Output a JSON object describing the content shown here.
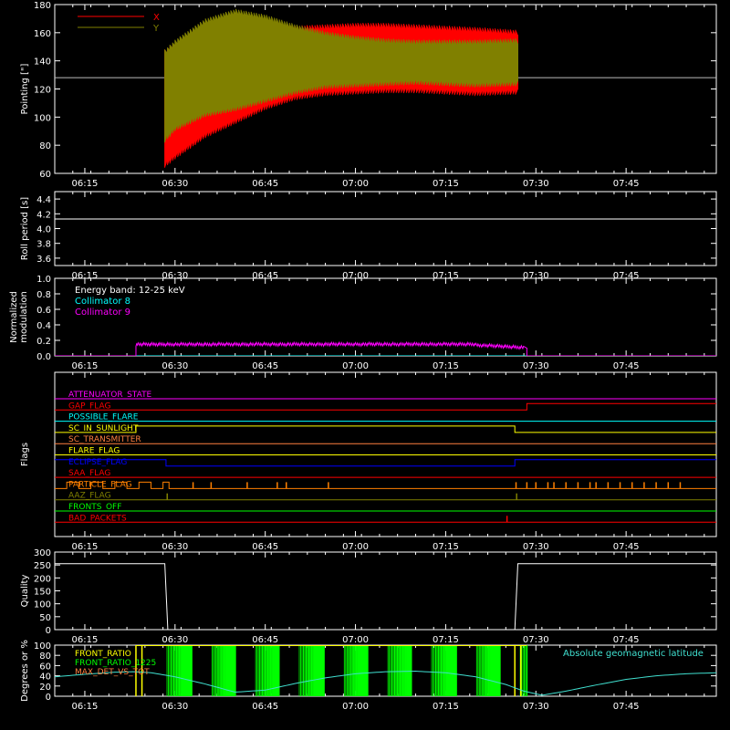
{
  "time_axis": {
    "min_minutes": 370,
    "max_minutes": 480,
    "tick_labels": [
      "06:15",
      "06:30",
      "06:45",
      "07:00",
      "07:15",
      "07:30",
      "07:45"
    ],
    "tick_minutes": [
      375,
      390,
      405,
      420,
      435,
      450,
      465
    ]
  },
  "chart_data": [
    {
      "type": "area",
      "ylabel": "Pointing [\"]",
      "ylim": [
        60,
        180
      ],
      "yticks": [
        60,
        80,
        100,
        120,
        140,
        160,
        180
      ],
      "grid": false,
      "legend_position": "top-left",
      "reference_line": 128,
      "series": [
        {
          "name": "X",
          "color": "#ff0000",
          "band": {
            "t": [
              388.3,
              390,
              395,
              400,
              405,
              410,
              415,
              420,
              425,
              430,
              435,
              440,
              447
            ],
            "upper": [
              148,
              152,
              158,
              163,
              166,
              165,
              166,
              167,
              167,
              166,
              165,
              164,
              162
            ],
            "lower": [
              64,
              70,
              85,
              95,
              105,
              112,
              115,
              116,
              117,
              117,
              116,
              115,
              116
            ]
          }
        },
        {
          "name": "Y",
          "color": "#808000",
          "band": {
            "t": [
              388.3,
              390,
              395,
              400,
              405,
              410,
              415,
              420,
              425,
              430,
              435,
              440,
              447
            ],
            "upper": [
              148,
              155,
              170,
              177,
              173,
              166,
              161,
              158,
              156,
              155,
              155,
              155,
              156
            ],
            "lower": [
              82,
              90,
              100,
              104,
              110,
              116,
              120,
              121,
              122,
              123,
              122,
              121,
              122
            ]
          }
        }
      ]
    },
    {
      "type": "line",
      "ylabel": "Roll period [s]",
      "ylim": [
        3.5,
        4.5
      ],
      "yticks": [
        3.6,
        3.8,
        4.0,
        4.2,
        4.4
      ],
      "tick_labels": [
        "3.6",
        "3.8",
        "4.0",
        "4.2",
        "4.4"
      ],
      "grid": false,
      "series": [
        {
          "name": "",
          "color": "#ffffff",
          "x": [
            370,
            480
          ],
          "y": [
            4.13,
            4.13
          ]
        }
      ]
    },
    {
      "type": "line",
      "ylabel": [
        "Normalized",
        "modulation"
      ],
      "ylim": [
        0.0,
        1.0
      ],
      "yticks": [
        0.0,
        0.2,
        0.4,
        0.6,
        0.8,
        1.0
      ],
      "tick_labels": [
        "0.0",
        "0.2",
        "0.4",
        "0.6",
        "0.8",
        "1.0"
      ],
      "annotation": "Energy band: 12-25 keV",
      "grid": false,
      "series": [
        {
          "name": "Collimator 8",
          "color": "#00ffff",
          "x": [
            370,
            480
          ],
          "y": [
            0,
            0
          ]
        },
        {
          "name": "Collimator 9",
          "color": "#ff00ff",
          "x": [
            370,
            383.5,
            383.5,
            390,
            400,
            410,
            420,
            430,
            440,
            448,
            448.5,
            448.5,
            480
          ],
          "y": [
            0,
            0,
            0.15,
            0.16,
            0.15,
            0.15,
            0.15,
            0.16,
            0.14,
            0.13,
            0.1,
            0,
            0
          ]
        }
      ]
    },
    {
      "type": "line",
      "ylabel": "Flags",
      "grid": false,
      "series": [
        {
          "name": "ATTENUATOR_STATE",
          "color": "#ff00ff",
          "x": [
            370,
            480
          ],
          "y": [
            0,
            0
          ]
        },
        {
          "name": "GAP_FLAG",
          "color": "#ff0000",
          "x": [
            370,
            448.5,
            448.5,
            480
          ],
          "y": [
            0,
            0,
            1,
            1
          ]
        },
        {
          "name": "POSSIBLE_FLARE",
          "color": "#00ffff",
          "x": [
            370,
            480
          ],
          "y": [
            0,
            0
          ]
        },
        {
          "name": "SC_IN_SUNLIGHT",
          "color": "#ffff00",
          "x": [
            370,
            383.5,
            383.5,
            388.5,
            388.5,
            446.5,
            446.5,
            480
          ],
          "y": [
            0,
            0,
            1,
            1,
            1,
            1,
            0,
            0
          ]
        },
        {
          "name": "SC_TRANSMITTER",
          "color": "#ff8040",
          "x": [
            370,
            480
          ],
          "y": [
            0,
            0
          ]
        },
        {
          "name": "FLARE_FLAG",
          "color": "#ffff00",
          "x": [
            370,
            480
          ],
          "y": [
            0,
            0
          ]
        },
        {
          "name": "ECLIPSE_FLAG",
          "color": "#0000ff",
          "x": [
            370,
            388.5,
            388.5,
            446.5,
            446.5,
            480
          ],
          "y": [
            1,
            1,
            0,
            0,
            1,
            1
          ]
        },
        {
          "name": "SAA_FLAG",
          "color": "#ff0000",
          "x": [
            370,
            480
          ],
          "y": [
            0,
            0
          ]
        },
        {
          "name": "PARTICLE_FLAG",
          "color": "#ff8000",
          "x": [
            370,
            372,
            372,
            374,
            374,
            376,
            376,
            378,
            378,
            380,
            380,
            382,
            382,
            384,
            384,
            386,
            386,
            388,
            388,
            389,
            389,
            480
          ],
          "y": [
            0,
            0,
            1,
            1,
            0,
            0,
            1,
            1,
            0,
            0,
            1,
            1,
            0,
            0,
            1,
            1,
            0,
            0,
            1,
            1,
            0,
            0
          ],
          "spikes": [
            393,
            396,
            402,
            407,
            408.5,
            415.5,
            446.7,
            448.5,
            450,
            452,
            453,
            455,
            457,
            459,
            460,
            462,
            464,
            466,
            468,
            470,
            472,
            474
          ]
        },
        {
          "name": "AAZ_FLAG",
          "color": "#808000",
          "x": [
            370,
            480
          ],
          "y": [
            0,
            0
          ],
          "spikes": [
            388.7,
            446.8
          ]
        },
        {
          "name": "FRONTS_OFF",
          "color": "#00ff00",
          "x": [
            370,
            480
          ],
          "y": [
            0,
            0
          ]
        },
        {
          "name": "BAD_PACKETS",
          "color": "#ff0000",
          "x": [
            370,
            480
          ],
          "y": [
            0,
            0
          ],
          "spikes": [
            445.2
          ]
        }
      ]
    },
    {
      "type": "line",
      "ylabel": "Quality",
      "ylim": [
        0,
        300
      ],
      "yticks": [
        0,
        50,
        100,
        150,
        200,
        250,
        300
      ],
      "tick_labels": [
        "0",
        "50",
        "100",
        "150",
        "200",
        "250",
        "300"
      ],
      "grid": false,
      "series": [
        {
          "name": "",
          "color": "#ffffff",
          "x": [
            370,
            388.3,
            388.8,
            446.5,
            447,
            480
          ],
          "y": [
            255,
            255,
            0,
            0,
            255,
            255
          ]
        }
      ]
    },
    {
      "type": "bar",
      "ylabel": "Degrees or %",
      "ylim": [
        0,
        100
      ],
      "yticks": [
        0,
        20,
        40,
        60,
        80,
        100
      ],
      "tick_labels": [
        "0",
        "20",
        "40",
        "60",
        "80",
        "100"
      ],
      "grid": false,
      "series": [
        {
          "name": "FRONT_RATIO",
          "color": "#ffff00",
          "x": [
            383.5,
            384.5,
            446.5,
            447.5
          ],
          "y": [
            100,
            100,
            100,
            100
          ]
        },
        {
          "name": "FRONT_RATIO_1225",
          "color": "#00ff00",
          "region": [
            388.6,
            448.5
          ],
          "y": 100
        },
        {
          "name": "MAX_DET_VS_TOT",
          "color": "#ff8040",
          "x": [],
          "y": []
        },
        {
          "name": "Absolute geomagnetic latitude",
          "color": "#40e0d0",
          "x": [
            370,
            375,
            380,
            383,
            386,
            390,
            395,
            400,
            405,
            410,
            415,
            420,
            425,
            430,
            435,
            440,
            445,
            448,
            451,
            455,
            460,
            465,
            470,
            475,
            480
          ],
          "y": [
            38,
            43,
            47,
            48,
            46,
            38,
            24,
            8,
            12,
            25,
            36,
            44,
            48,
            49,
            46,
            38,
            23,
            10,
            2,
            10,
            22,
            33,
            40,
            44,
            46
          ]
        }
      ]
    }
  ]
}
